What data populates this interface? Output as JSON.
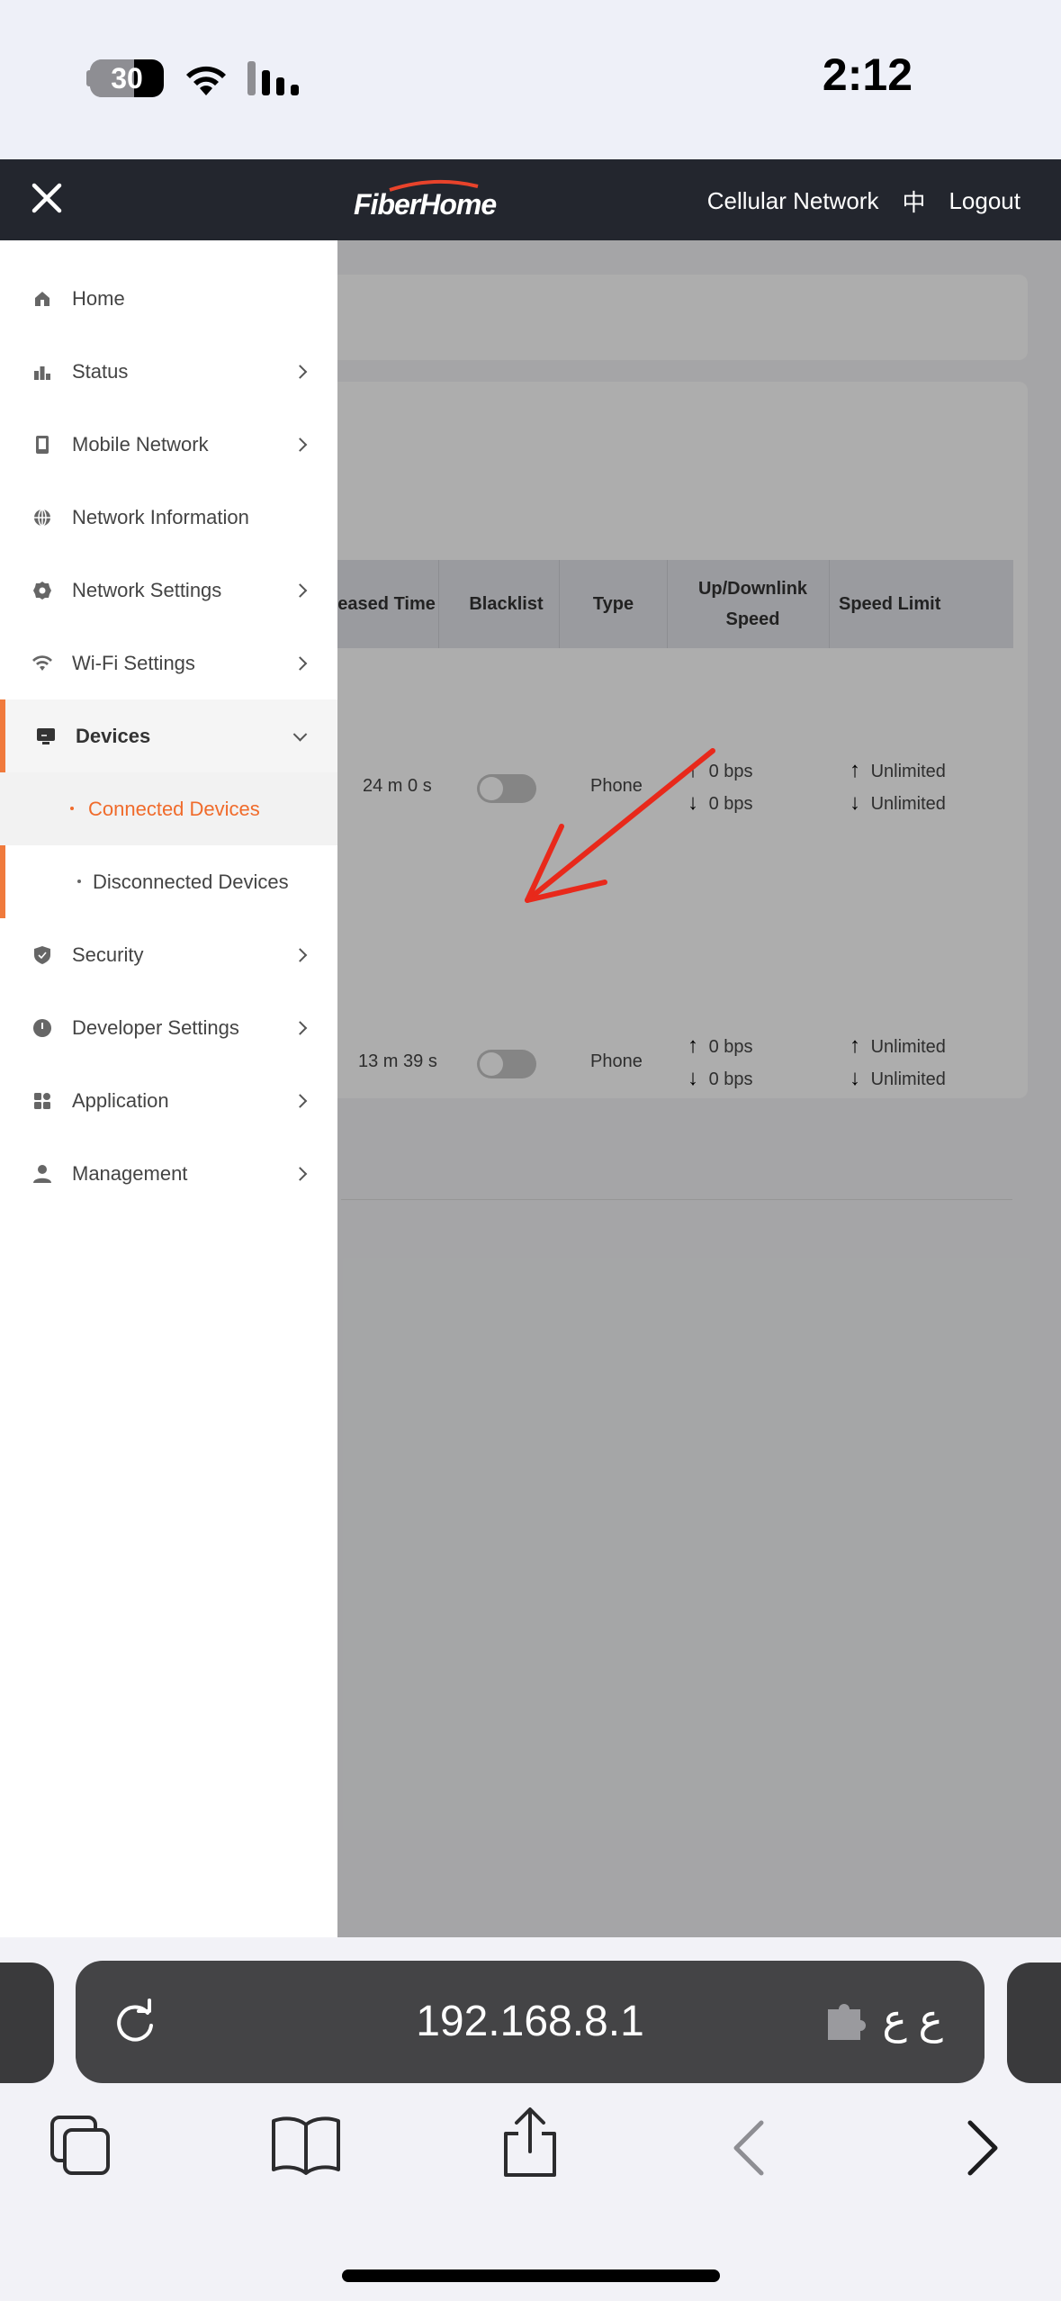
{
  "status_bar": {
    "battery": "30",
    "time": "2:12"
  },
  "header": {
    "logo": "FiberHome",
    "network": "Cellular Network",
    "lang": "中",
    "logout": "Logout"
  },
  "table": {
    "headers": [
      "Leased Time",
      "Blacklist",
      "Type",
      "Up/Downlink Speed",
      "Speed Limit"
    ],
    "rows": [
      {
        "leased": "24 m 0 s",
        "type": "Phone",
        "up": "0 bps",
        "down": "0 bps",
        "limit_up": "Unlimited",
        "limit_down": "Unlimited",
        "blacklist": false
      },
      {
        "leased": "13 m 39 s",
        "type": "Phone",
        "up": "0 bps",
        "down": "0 bps",
        "limit_up": "Unlimited",
        "limit_down": "Unlimited",
        "blacklist": false
      }
    ]
  },
  "sidebar": {
    "items": [
      {
        "label": "Home",
        "icon": "home-icon"
      },
      {
        "label": "Status",
        "icon": "bar-chart-icon"
      },
      {
        "label": "Mobile Network",
        "icon": "phone-icon"
      },
      {
        "label": "Network Information",
        "icon": "globe-icon"
      },
      {
        "label": "Network Settings",
        "icon": "gear-icon"
      },
      {
        "label": "Wi-Fi Settings",
        "icon": "wifi-icon"
      },
      {
        "label": "Devices",
        "icon": "monitor-icon"
      },
      {
        "label": "Security",
        "icon": "shield-icon"
      },
      {
        "label": "Developer Settings",
        "icon": "alert-icon"
      },
      {
        "label": "Application",
        "icon": "apps-icon"
      },
      {
        "label": "Management",
        "icon": "user-icon"
      }
    ],
    "devices_sub": [
      "Connected Devices",
      "Disconnected Devices"
    ]
  },
  "browser": {
    "url": "192.168.8.1",
    "text_size": "ع ع"
  },
  "colors": {
    "accent": "#f06b2b",
    "header_bg": "#23262e"
  }
}
